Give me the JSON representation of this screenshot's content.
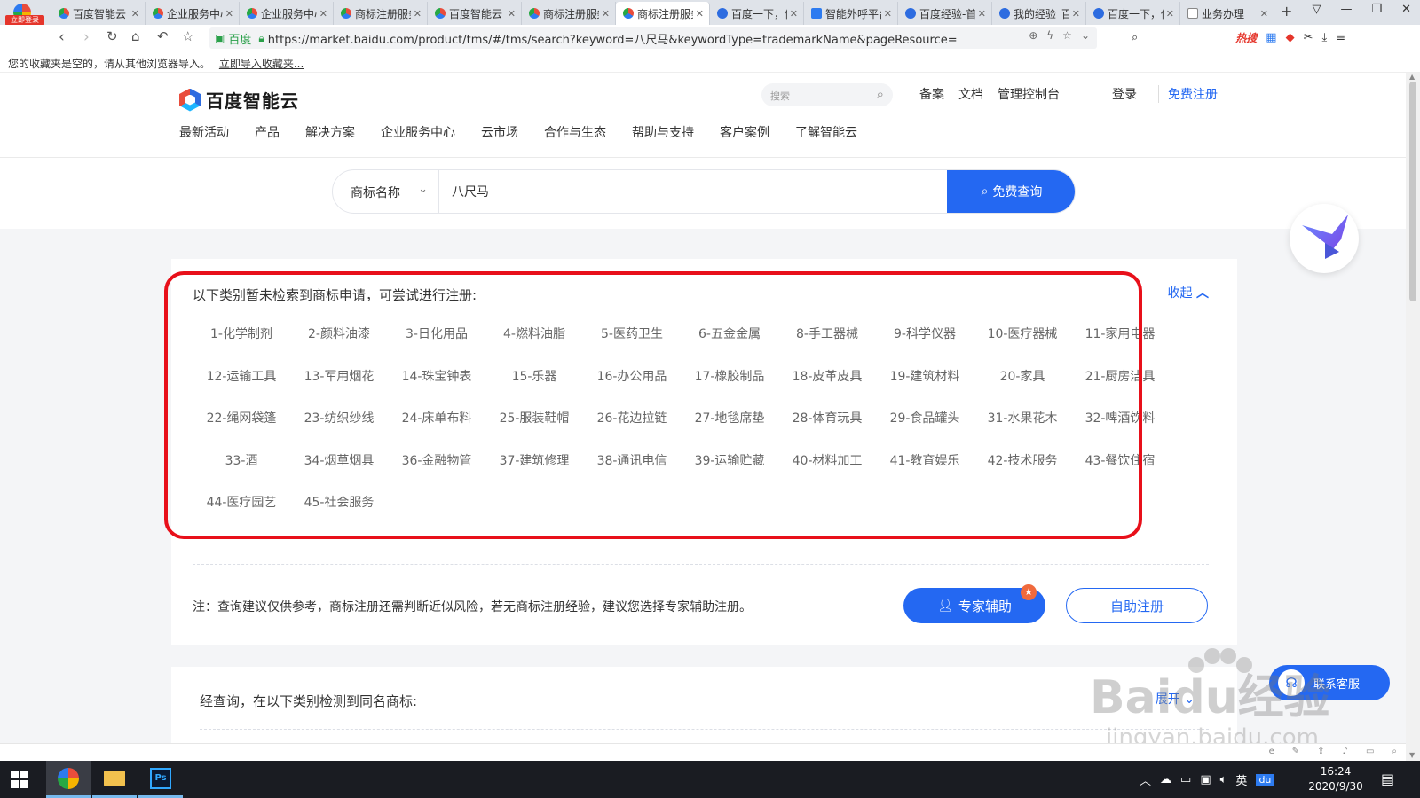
{
  "browser": {
    "badge": "立即登录",
    "tabs": [
      {
        "title": "百度智能云",
        "icon": "cloud",
        "active": false
      },
      {
        "title": "企业服务中心",
        "icon": "cloud",
        "active": false
      },
      {
        "title": "企业服务中心",
        "icon": "cloud",
        "active": false
      },
      {
        "title": "商标注册服务",
        "icon": "cloud",
        "active": false
      },
      {
        "title": "百度智能云",
        "icon": "cloud",
        "active": false
      },
      {
        "title": "商标注册服务",
        "icon": "cloud",
        "active": false
      },
      {
        "title": "商标注册服务",
        "icon": "cloud",
        "active": true
      },
      {
        "title": "百度一下，你",
        "icon": "paw",
        "active": false
      },
      {
        "title": "智能外呼平台",
        "icon": "ai",
        "active": false
      },
      {
        "title": "百度经验-首页",
        "icon": "paw",
        "active": false
      },
      {
        "title": "我的经验_百度",
        "icon": "paw",
        "active": false
      },
      {
        "title": "百度一下，你",
        "icon": "paw",
        "active": false
      },
      {
        "title": "业务办理",
        "icon": "doc",
        "active": false
      }
    ],
    "address": {
      "label": "百度",
      "url": "https://market.baidu.com/product/tms/#/tms/search?keyword=八尺马&keywordType=trademarkName&pageResource="
    },
    "hot_search": "热搜",
    "bookmark_bar": {
      "text": "您的收藏夹是空的，请从其他浏览器导入。",
      "link": "立即导入收藏夹..."
    }
  },
  "site": {
    "brand": "百度智能云",
    "search_placeholder": "搜索",
    "top_links": [
      "备案",
      "文档",
      "管理控制台"
    ],
    "login": "登录",
    "signup": "免费注册",
    "nav": [
      "最新活动",
      "产品",
      "解决方案",
      "企业服务中心",
      "云市场",
      "合作与生态",
      "帮助与支持",
      "客户案例",
      "了解智能云"
    ]
  },
  "search": {
    "type": "商标名称",
    "keyword": "八尺马",
    "button": "免费查询"
  },
  "result": {
    "title": "以下类别暂未检索到商标申请，可尝试进行注册:",
    "collapse": "收起",
    "classes": [
      "1-化学制剂",
      "2-颜料油漆",
      "3-日化用品",
      "4-燃料油脂",
      "5-医药卫生",
      "6-五金金属",
      "8-手工器械",
      "9-科学仪器",
      "10-医疗器械",
      "11-家用电器",
      "12-运输工具",
      "13-军用烟花",
      "14-珠宝钟表",
      "15-乐器",
      "16-办公用品",
      "17-橡胶制品",
      "18-皮革皮具",
      "19-建筑材料",
      "20-家具",
      "21-厨房洁具",
      "22-绳网袋篷",
      "23-纺织纱线",
      "24-床单布料",
      "25-服装鞋帽",
      "26-花边拉链",
      "27-地毯席垫",
      "28-体育玩具",
      "29-食品罐头",
      "31-水果花木",
      "32-啤酒饮料",
      "33-酒",
      "34-烟草烟具",
      "36-金融物管",
      "37-建筑修理",
      "38-通讯电信",
      "39-运输贮藏",
      "40-材料加工",
      "41-教育娱乐",
      "42-技术服务",
      "43-餐饮住宿",
      "44-医疗园艺",
      "45-社会服务"
    ],
    "note": "注：查询建议仅供参考，商标注册还需判断近似风险，若无商标注册经验，建议您选择专家辅助注册。",
    "expert_button": "专家辅助",
    "self_button": "自助注册"
  },
  "duplicate": {
    "title": "经查询，在以下类别检测到同名商标:",
    "expand": "展开"
  },
  "contact": "联系客服",
  "watermark": {
    "logo": "Baidu经验",
    "url": "jingyan.baidu.com"
  },
  "taskbar": {
    "ime": "英",
    "time": "16:24",
    "date": "2020/9/30"
  },
  "colors": {
    "accent": "#2468f2",
    "highlight_border": "#e8101a",
    "hot": "#e5352b"
  }
}
